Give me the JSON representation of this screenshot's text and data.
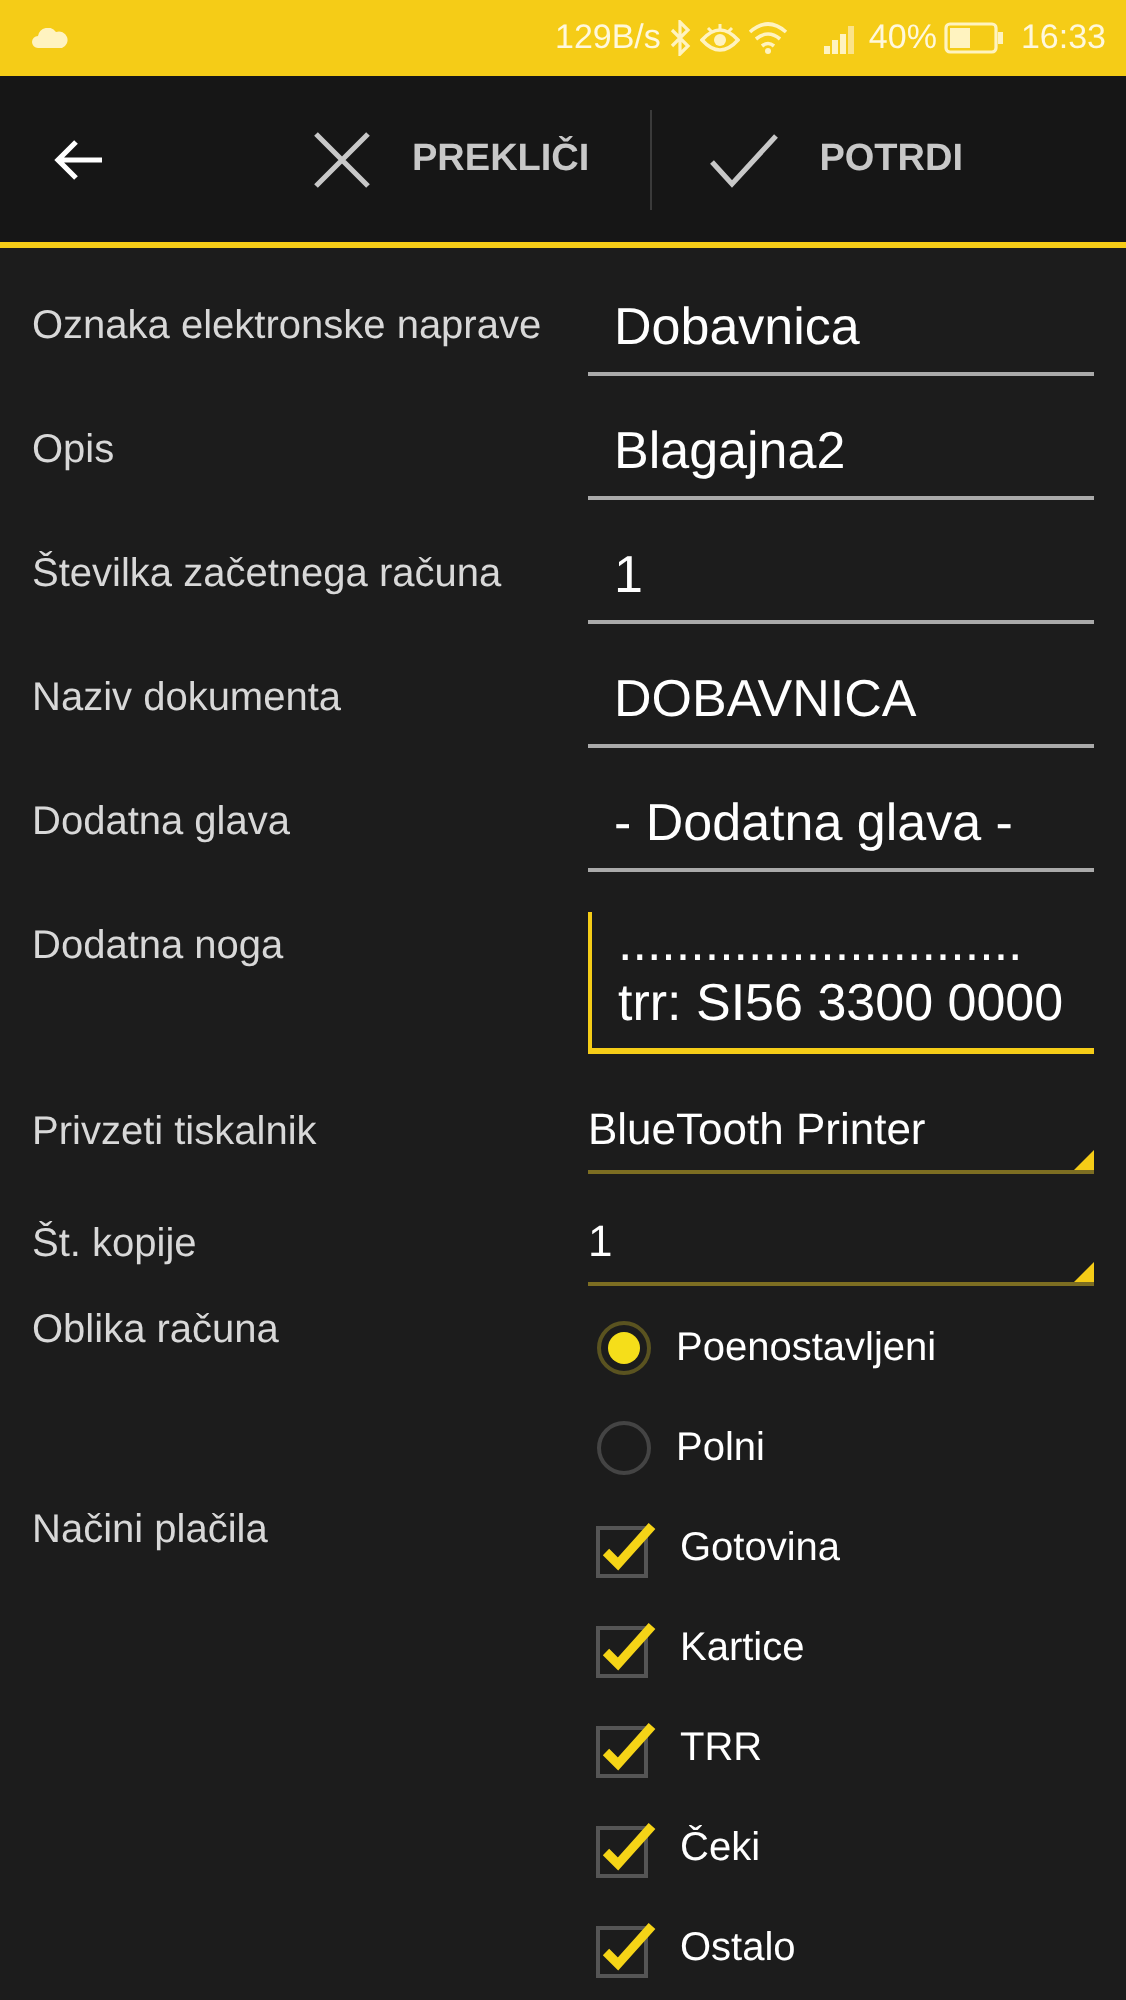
{
  "status_bar": {
    "network_speed": "129B/s",
    "battery": "40%",
    "time": "16:33"
  },
  "toolbar": {
    "cancel": "PREKLIČI",
    "confirm": "POTRDI"
  },
  "fields": [
    {
      "kind": "text",
      "label": "Oznaka elektronske naprave",
      "value": "Dobavnica",
      "focused": false
    },
    {
      "kind": "text",
      "label": "Opis",
      "value": "Blagajna2",
      "focused": false
    },
    {
      "kind": "text",
      "label": "Številka začetnega računa",
      "value": "1",
      "focused": false
    },
    {
      "kind": "text",
      "label": "Naziv dokumenta",
      "value": "DOBAVNICA",
      "focused": false
    },
    {
      "kind": "text",
      "label": "Dodatna glava",
      "value": "- Dodatna glava -",
      "focused": false
    },
    {
      "kind": "multiline",
      "label": "Dodatna noga",
      "lines": [
        "............................",
        "trr: SI56 3300 0000"
      ],
      "focused": true
    },
    {
      "kind": "spinner",
      "label": "Privzeti tiskalnik",
      "value": "BlueTooth Printer"
    },
    {
      "kind": "spinner",
      "label": "Št. kopije",
      "value": "1"
    },
    {
      "kind": "radio",
      "label": "Oblika računa",
      "options": [
        {
          "label": "Poenostavljeni",
          "selected": true
        },
        {
          "label": "Polni",
          "selected": false
        }
      ]
    },
    {
      "kind": "checkbox",
      "label": "Načini plačila",
      "options": [
        {
          "label": "Gotovina",
          "checked": true
        },
        {
          "label": "Kartice",
          "checked": true
        },
        {
          "label": "TRR",
          "checked": true
        },
        {
          "label": "Čeki",
          "checked": true
        },
        {
          "label": "Ostalo",
          "checked": true
        }
      ]
    }
  ]
}
